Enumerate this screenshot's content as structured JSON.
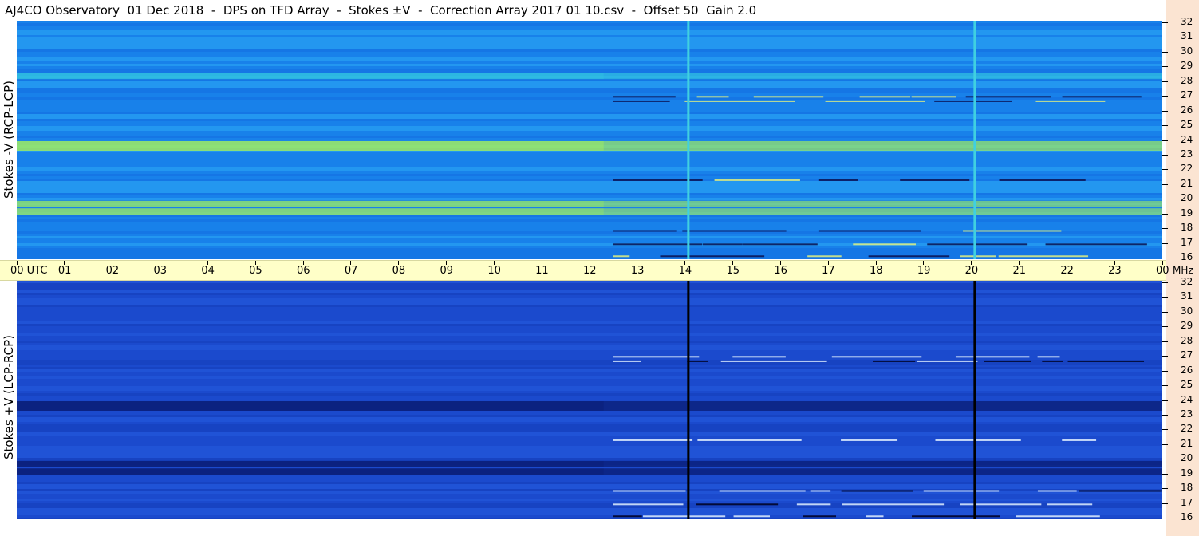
{
  "title": "AJ4CO Observatory  01 Dec 2018  -  DPS on TFD Array  -  Stokes ±V  -  Correction Array 2017 01 10.csv  -  Offset 50  Gain 2.0",
  "panels": {
    "top_label": "Stokes -V (RCP-LCP)",
    "bottom_label": "Stokes +V (LCP-RCP)"
  },
  "time_axis": {
    "labels": [
      "00  UTC",
      "01",
      "02",
      "03",
      "04",
      "05",
      "06",
      "07",
      "08",
      "09",
      "10",
      "11",
      "12",
      "13",
      "14",
      "15",
      "16",
      "17",
      "18",
      "19",
      "20",
      "21",
      "22",
      "23",
      "00"
    ],
    "unit": "MHz"
  },
  "freq_axis": {
    "labels": [
      "32",
      "31",
      "30",
      "29",
      "28",
      "27",
      "26",
      "25",
      "24",
      "23",
      "22",
      "21",
      "20",
      "19",
      "18",
      "17",
      "16"
    ]
  },
  "colors": {
    "title_bg": "#ffffff",
    "time_bar_bg": "#ffffc8",
    "right_strip_bg": "#fbe4d2",
    "top_base": "#1e8cf0",
    "bottom_base": "#1e50d2"
  },
  "chart_data": {
    "type": "heatmap",
    "title": "AJ4CO Observatory  01 Dec 2018  -  DPS on TFD Array  -  Stokes ±V  -  Correction Array 2017 01 10.csv  -  Offset 50  Gain 2.0",
    "x_unit": "UTC hours",
    "xlim": [
      0,
      24
    ],
    "y_unit": "MHz",
    "ylim": [
      16,
      32
    ],
    "panels": [
      {
        "name": "Stokes -V (RCP-LCP)",
        "bright_bands_MHz": [
          23.6,
          19.7,
          19.2,
          28.3
        ],
        "vertical_lines_UTC": [
          14.07,
          20.07
        ]
      },
      {
        "name": "Stokes +V (LCP-RCP)",
        "dark_bands_MHz": [
          23.6,
          19.7,
          19.2
        ],
        "vertical_lines_UTC": [
          14.07,
          20.07
        ]
      }
    ]
  }
}
